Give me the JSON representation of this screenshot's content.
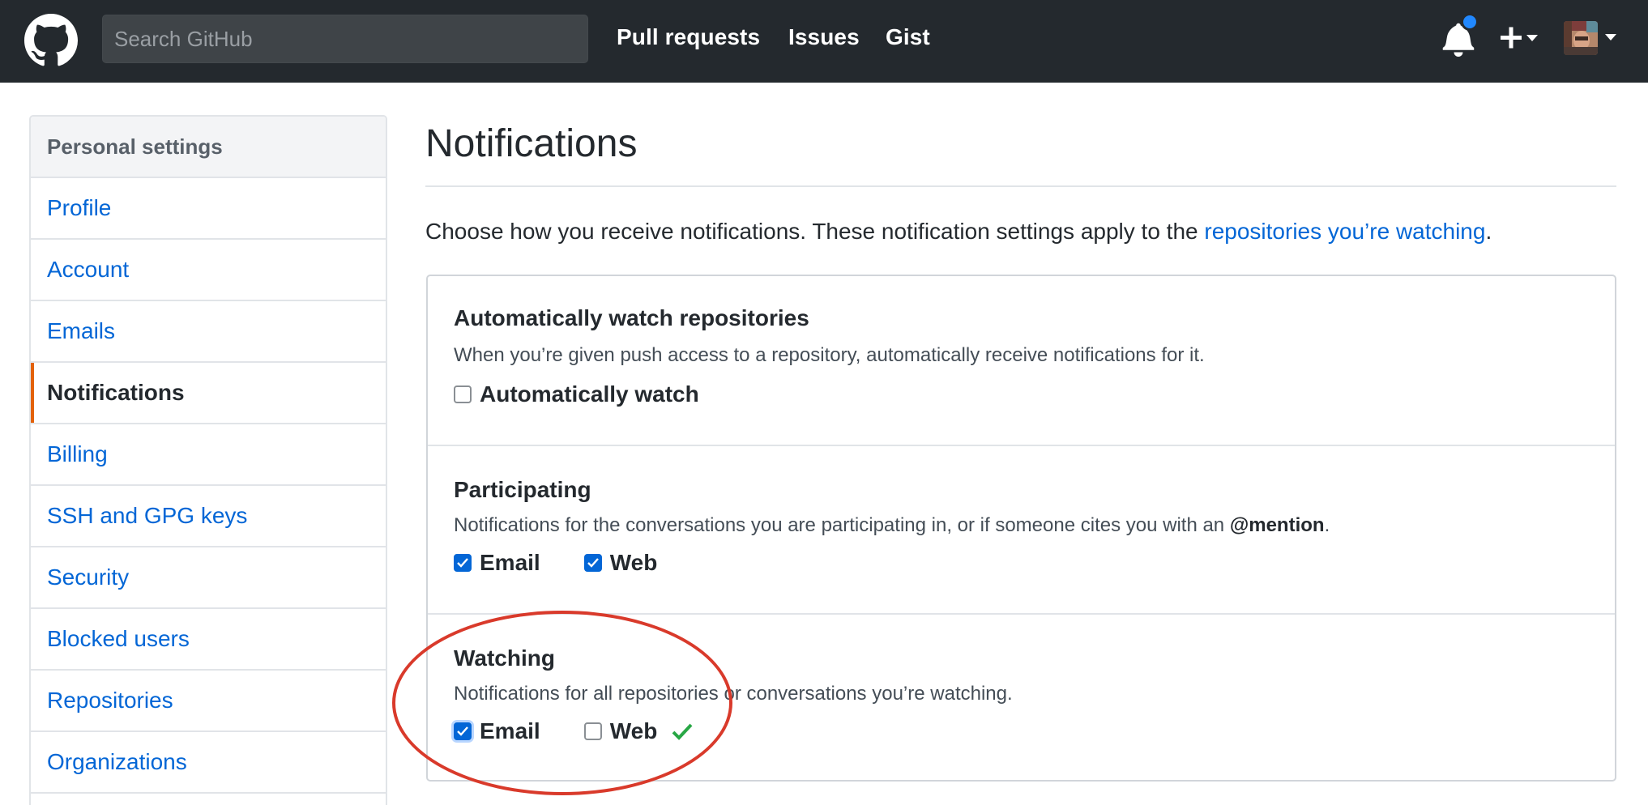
{
  "header": {
    "search_placeholder": "Search GitHub",
    "nav": [
      "Pull requests",
      "Issues",
      "Gist"
    ]
  },
  "sidebar": {
    "heading": "Personal settings",
    "items": [
      {
        "label": "Profile"
      },
      {
        "label": "Account"
      },
      {
        "label": "Emails"
      },
      {
        "label": "Notifications",
        "active": true
      },
      {
        "label": "Billing"
      },
      {
        "label": "SSH and GPG keys"
      },
      {
        "label": "Security"
      },
      {
        "label": "Blocked users"
      },
      {
        "label": "Repositories"
      },
      {
        "label": "Organizations"
      }
    ]
  },
  "main": {
    "title": "Notifications",
    "intro_text": "Choose how you receive notifications. These notification settings apply to the ",
    "intro_link": "repositories you’re watching",
    "intro_end": ".",
    "sections": {
      "auto": {
        "title": "Automatically watch repositories",
        "desc": "When you’re given push access to a repository, automatically receive notifications for it.",
        "checkbox_label": "Automatically watch",
        "checked": false
      },
      "participating": {
        "title": "Participating",
        "desc_pre": "Notifications for the conversations you are participating in, or if someone cites you with an ",
        "desc_mention": "@mention",
        "desc_post": ".",
        "email_label": "Email",
        "web_label": "Web",
        "email_checked": true,
        "web_checked": true
      },
      "watching": {
        "title": "Watching",
        "desc": "Notifications for all repositories or conversations you’re watching.",
        "email_label": "Email",
        "web_label": "Web",
        "email_checked": true,
        "web_checked": false
      }
    }
  },
  "colors": {
    "header_bg": "#24292e",
    "link": "#0366d6",
    "active_marker": "#e36209",
    "notification_dot": "#2188ff",
    "success": "#28a745",
    "annotation": "#d93a2b"
  },
  "icons": [
    "github-logo-icon",
    "bell-icon",
    "plus-icon",
    "caret-down-icon",
    "checkmark-icon"
  ]
}
